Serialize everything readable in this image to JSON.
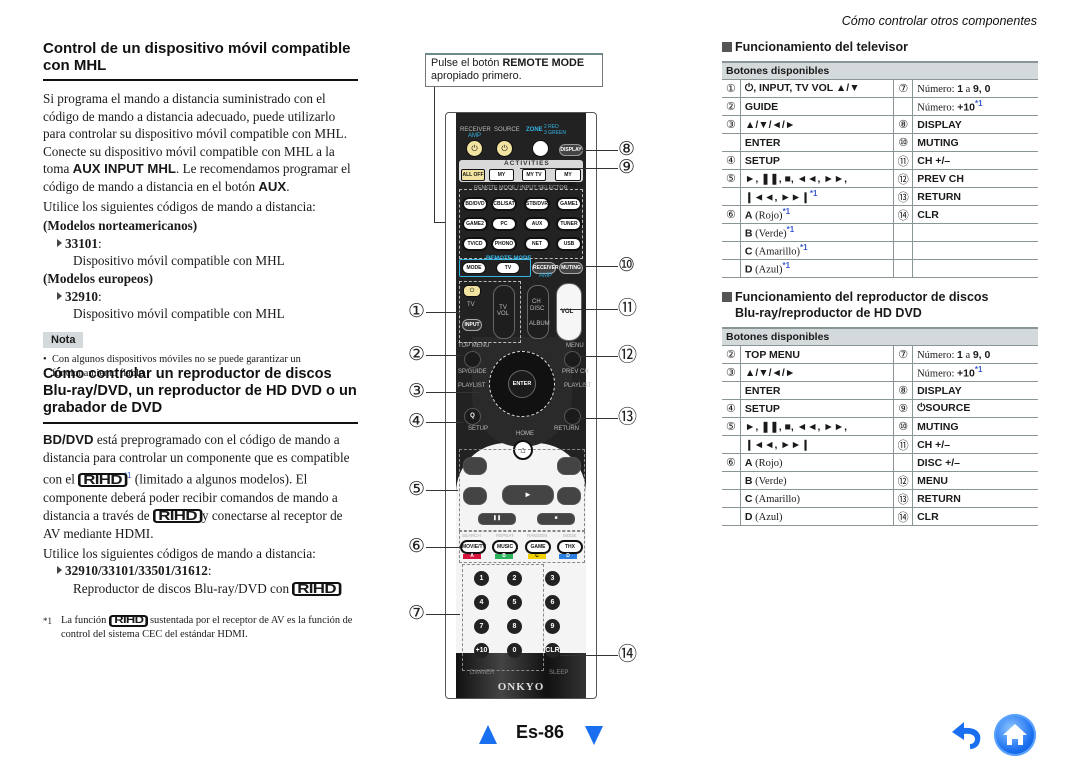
{
  "running_header": "Cómo controlar otros componentes",
  "left": {
    "mhl": {
      "title": "Control de un dispositivo móvil compatible con MHL",
      "para1_a": "Si programa el mando a distancia suministrado con el código de mando a distancia adecuado, puede utilizarlo para controlar su dispositivo móvil compatible con MHL.",
      "para2_a": "Conecte su dispositivo móvil compatible con MHL a la toma ",
      "para2_b": "AUX INPUT MHL",
      "para2_c": ". Le recomendamos programar el código de mando a distancia en el botón ",
      "para2_d": "AUX",
      "para2_e": ".",
      "para3": "Utilice los siguientes códigos de mando a distancia:",
      "na_label": "(Modelos norteamericanos)",
      "na_code": "33101",
      "na_desc": "Dispositivo móvil compatible con MHL",
      "eu_label": "(Modelos europeos)",
      "eu_code": "32910",
      "eu_desc": "Dispositivo móvil compatible con MHL",
      "note_label": "Nota",
      "note_text": "Con algunos dispositivos móviles no se puede garantizar un funcionamiento fiable."
    },
    "bd": {
      "title": "Cómo controlar un reproductor de discos Blu-ray/DVD, un reproductor de HD DVD o un grabador de DVD",
      "p_a": "BD/DVD",
      "p_b": " está preprogramado con el código de mando a distancia para controlar un componente que es compatible con el ",
      "rihd": "RIHD",
      "fn_mark": "*1",
      "p_c": " (limitado a algunos modelos). El componente deberá poder recibir comandos de mando a distancia a través de ",
      "p_d": " y conectarse al receptor de AV mediante HDMI.",
      "p2": "Utilice los siguientes códigos de mando a distancia:",
      "codes": "32910/33101/33501/31612",
      "codes_desc": "Reproductor de discos Blu-ray/DVD con ",
      "footnote_mark": "*1",
      "footnote_a": "La función ",
      "footnote_b": " sustentada por el receptor de AV es la función de control del sistema CEC del estándar HDMI."
    }
  },
  "remote": {
    "instruction_a": "Pulse el botón ",
    "instruction_b": "REMOTE MODE",
    "instruction_c": " apropiado primero.",
    "labels": {
      "receiver": "RECEIVER",
      "amp": "AMP",
      "source": "SOURCE",
      "zone": "ZONE",
      "zone_sub1": "2 RED",
      "zone_sub2": "3 GREEN",
      "display": "DISPLAY",
      "activities": "ACTIVITIES",
      "all_off": "ALL OFF",
      "my_movie": "MY MOVIE",
      "my_tv": "MY TV",
      "my_music": "MY MUSIC",
      "input_selector": "REMOTE MODE / INPUT SELECTOR",
      "selectors": [
        "BD/DVD",
        "CBL/SAT",
        "STB/DVR",
        "GAME1",
        "GAME2",
        "PC",
        "AUX",
        "TUNER",
        "TV/CD",
        "PHONO",
        "NET",
        "USB"
      ],
      "remote_mode": "REMOTE MODE",
      "mode": "MODE",
      "tv": "TV",
      "receiver_btn": "RECEIVER",
      "muting": "MUTING",
      "tv_label": "TV",
      "tv_vol": "TV VOL",
      "input": "INPUT",
      "ch": "CH",
      "disc": "DISC",
      "album": "ALBUM",
      "vol": "VOL",
      "top_menu": "TOP MENU",
      "menu": "MENU",
      "sp_guide": "SP/GUIDE",
      "prev_ch": "PREV CH",
      "playlist_l": "PLAYLIST",
      "playlist_r": "PLAYLIST",
      "enter": "ENTER",
      "q": "Q",
      "setup": "SETUP",
      "return": "RETURN",
      "home": "HOME",
      "search": "SEARCH",
      "repeat": "REPEAT",
      "random": "RANDOM",
      "mode2": "MODE",
      "movie_tv": "MOVIE/TV",
      "music": "MUSIC",
      "game": "GAME",
      "thx": "THX",
      "a": "A",
      "b": "B",
      "c": "C",
      "d": "D",
      "digits": [
        "1",
        "2",
        "3",
        "4",
        "5",
        "6",
        "7",
        "8",
        "9",
        "+10",
        "0",
        "CLR"
      ],
      "dimmer": "DIMMER",
      "sleep": "SLEEP",
      "brand": "ONKYO"
    },
    "color_keys": {
      "a": "#d8143c",
      "b": "#2ab25a",
      "c": "#f0d000",
      "d": "#2a7fe0"
    },
    "callouts_left": [
      "①",
      "②",
      "③",
      "④",
      "⑤",
      "⑥",
      "⑦"
    ],
    "callouts_right": [
      "⑧",
      "⑨",
      "⑩",
      "⑪",
      "⑫",
      "⑬",
      "⑭"
    ]
  },
  "tv_table": {
    "section_title": "Funcionamiento del televisor",
    "header": "Botones disponibles",
    "rows": [
      {
        "n1": "①",
        "l": "⏻, INPUT, TV VOL ▲/▼",
        "n2": "⑦",
        "r": "Número: 1 a 9, 0"
      },
      {
        "n1": "②",
        "l": "GUIDE",
        "n2": "",
        "r": "Número: +10",
        "r_fn": "*1"
      },
      {
        "n1": "③",
        "l": "▲/▼/◄/►",
        "n2": "⑧",
        "r": "DISPLAY"
      },
      {
        "n1": "",
        "l": "ENTER",
        "n2": "⑩",
        "r": "MUTING"
      },
      {
        "n1": "④",
        "l": "SETUP",
        "n2": "⑪",
        "r": "CH +/–"
      },
      {
        "n1": "⑤",
        "l": "►, ❚❚, ■, ◄◄, ►►,",
        "n2": "⑫",
        "r": "PREV CH"
      },
      {
        "n1": "",
        "l": "❙◄◄, ►►❙",
        "l_fn": "*1",
        "n2": "⑬",
        "r": "RETURN"
      },
      {
        "n1": "⑥",
        "l": "A",
        "l_desc": " (Rojo)",
        "l_fn": "*1",
        "n2": "⑭",
        "r": "CLR"
      },
      {
        "n1": "",
        "l": "B",
        "l_desc": " (Verde)",
        "l_fn": "*1",
        "n2": "",
        "r": ""
      },
      {
        "n1": "",
        "l": "C",
        "l_desc": " (Amarillo)",
        "l_fn": "*1",
        "n2": "",
        "r": ""
      },
      {
        "n1": "",
        "l": "D",
        "l_desc": " (Azul)",
        "l_fn": "*1",
        "n2": "",
        "r": ""
      }
    ]
  },
  "bd_table": {
    "section_title_1": "Funcionamiento del reproductor de discos",
    "section_title_2": "Blu-ray/reproductor de HD DVD",
    "header": "Botones disponibles",
    "rows": [
      {
        "n1": "②",
        "l": "TOP MENU",
        "n2": "⑦",
        "r": "Número: 1 a 9, 0"
      },
      {
        "n1": "③",
        "l": "▲/▼/◄/►",
        "n2": "",
        "r": "Número: +10",
        "r_fn": "*1"
      },
      {
        "n1": "",
        "l": "ENTER",
        "n2": "⑧",
        "r": "DISPLAY"
      },
      {
        "n1": "④",
        "l": "SETUP",
        "n2": "⑨",
        "r": "⏻SOURCE"
      },
      {
        "n1": "⑤",
        "l": "►, ❚❚, ■, ◄◄, ►►,",
        "n2": "⑩",
        "r": "MUTING"
      },
      {
        "n1": "",
        "l": "❙◄◄, ►►❙",
        "n2": "⑪",
        "r": "CH +/–"
      },
      {
        "n1": "⑥",
        "l": "A",
        "l_desc": " (Rojo)",
        "n2": "",
        "r": "DISC +/–"
      },
      {
        "n1": "",
        "l": "B",
        "l_desc": " (Verde)",
        "n2": "⑫",
        "r": "MENU"
      },
      {
        "n1": "",
        "l": "C",
        "l_desc": " (Amarillo)",
        "n2": "⑬",
        "r": "RETURN"
      },
      {
        "n1": "",
        "l": "D",
        "l_desc": " (Azul)",
        "n2": "⑭",
        "r": "CLR"
      }
    ]
  },
  "footer": {
    "page_label": "Es-86",
    "prev_icon": "triangle-up",
    "next_icon": "triangle-down",
    "back_icon": "back-arrow",
    "home_icon": "home",
    "accent": "#1a6ff0"
  }
}
